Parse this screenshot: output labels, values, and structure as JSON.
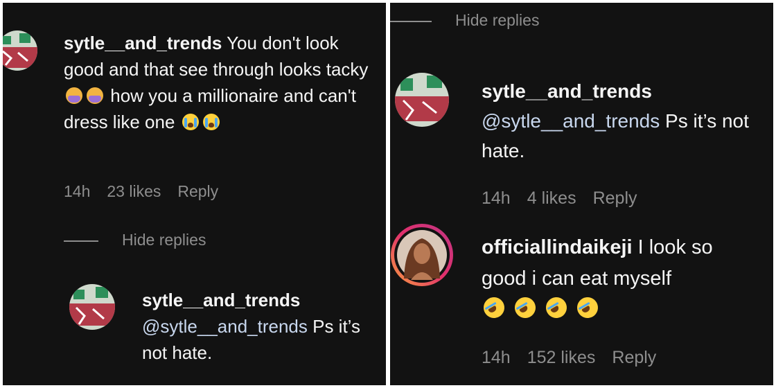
{
  "left_panel": {
    "comment": {
      "username": "sytle__and_trends",
      "text_parts": [
        "You don't look good and that see through looks tacky",
        "how you a millionaire and can't dress like one"
      ],
      "emojis_1": [
        "woman-facepalming-icon",
        "woman-facepalming-icon"
      ],
      "emojis_2": [
        "loudly-crying-face-icon",
        "loudly-crying-face-icon"
      ],
      "time": "14h",
      "likes": "23 likes",
      "reply": "Reply"
    },
    "hide_replies": "Hide replies",
    "reply_comment": {
      "username": "sytle__and_trends",
      "mention": "@sytle__and_trends",
      "text": "Ps it’s not hate."
    }
  },
  "right_panel": {
    "hide_replies": "Hide replies",
    "comment1": {
      "username": "sytle__and_trends",
      "mention": "@sytle__and_trends",
      "text": "Ps it’s not hate.",
      "time": "14h",
      "likes": "4 likes",
      "reply": "Reply"
    },
    "comment2": {
      "username": "officiallindaikeji",
      "text": "I look so good i can eat myself",
      "emojis": [
        "rolling-on-floor-laughing-icon",
        "rolling-on-floor-laughing-icon",
        "rolling-on-floor-laughing-icon",
        "rolling-on-floor-laughing-icon"
      ],
      "time": "14h",
      "likes": "152 likes",
      "reply": "Reply"
    }
  },
  "colors": {
    "background": "#121212",
    "text": "#f5f5f5",
    "meta": "#8e8e8e",
    "mention": "#c8d7ee",
    "story_ring": "#d6249f"
  }
}
